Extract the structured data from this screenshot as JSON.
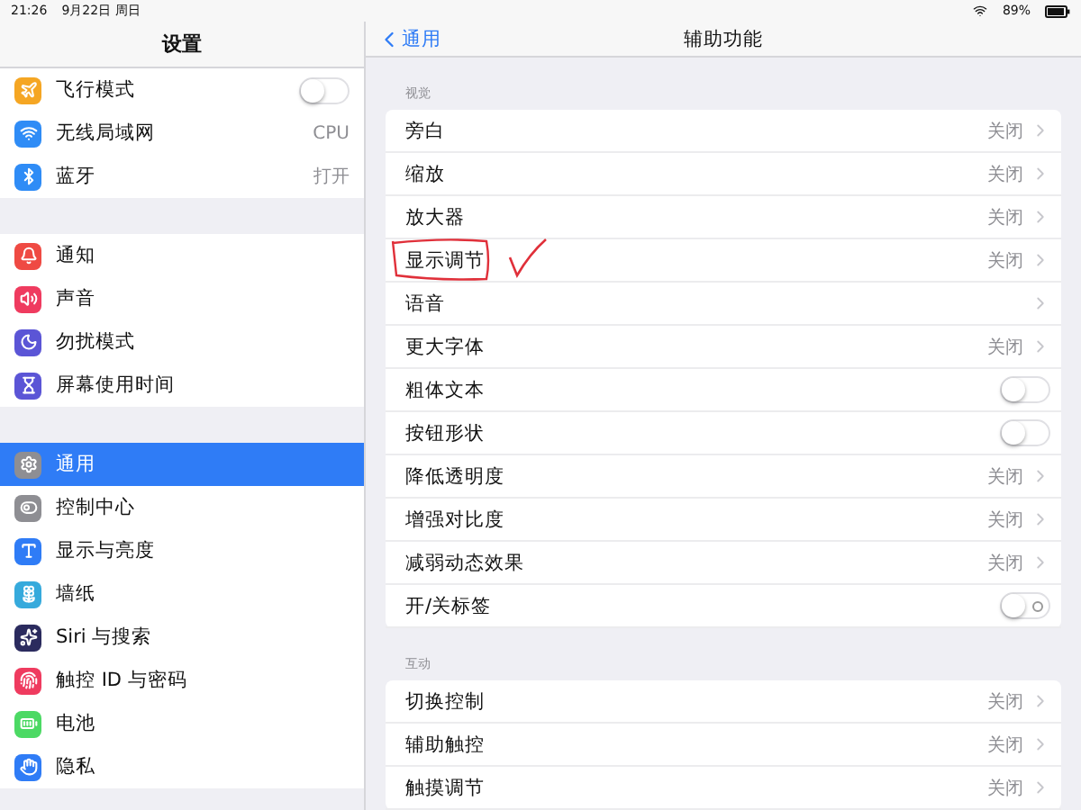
{
  "status_bar": {
    "time": "21:26",
    "date": "9月22日 周日",
    "battery": "89%"
  },
  "sidebar": {
    "title": "设置",
    "groups": [
      [
        {
          "label": "飞行模式",
          "color": "#f5a623",
          "kind": "toggle",
          "on": false
        },
        {
          "label": "无线局域网",
          "color": "#2f8cf6",
          "kind": "value",
          "value": "CPU"
        },
        {
          "label": "蓝牙",
          "color": "#2f8cf6",
          "kind": "value",
          "value": "打开"
        }
      ],
      [
        {
          "label": "通知",
          "color": "#ef4a43",
          "kind": "link"
        },
        {
          "label": "声音",
          "color": "#ef3b5f",
          "kind": "link"
        },
        {
          "label": "勿扰模式",
          "color": "#5b55d6",
          "kind": "link"
        },
        {
          "label": "屏幕使用时间",
          "color": "#5b55d6",
          "kind": "link"
        }
      ],
      [
        {
          "label": "通用",
          "color": "#8e8e93",
          "kind": "link",
          "selected": true
        },
        {
          "label": "控制中心",
          "color": "#8e8e93",
          "kind": "link",
          "selected": false
        },
        {
          "label": "显示与亮度",
          "color": "#2f7cf6",
          "kind": "link",
          "selected": false
        },
        {
          "label": "墙纸",
          "color": "#36aadc",
          "kind": "link",
          "selected": false
        },
        {
          "label": "Siri 与搜索",
          "color": "#2b2b5e",
          "kind": "link",
          "selected": false
        },
        {
          "label": "触控 ID 与密码",
          "color": "#ef3b5f",
          "kind": "link",
          "selected": false
        },
        {
          "label": "电池",
          "color": "#4cd964",
          "kind": "link",
          "selected": false
        },
        {
          "label": "隐私",
          "color": "#2f7cf6",
          "kind": "link",
          "selected": false
        }
      ]
    ]
  },
  "detail": {
    "back": "通用",
    "title": "辅助功能",
    "sections": [
      {
        "header": "视觉",
        "rows": [
          {
            "label": "旁白",
            "kind": "value",
            "value": "关闭"
          },
          {
            "label": "缩放",
            "kind": "value",
            "value": "关闭"
          },
          {
            "label": "放大器",
            "kind": "value",
            "value": "关闭"
          },
          {
            "label": "显示调节",
            "kind": "value",
            "value": "关闭",
            "annotated": true
          },
          {
            "label": "语音",
            "kind": "link"
          },
          {
            "label": "更大字体",
            "kind": "value",
            "value": "关闭"
          },
          {
            "label": "粗体文本",
            "kind": "toggle",
            "on": false
          },
          {
            "label": "按钮形状",
            "kind": "toggle",
            "on": false
          },
          {
            "label": "降低透明度",
            "kind": "value",
            "value": "关闭"
          },
          {
            "label": "增强对比度",
            "kind": "value",
            "value": "关闭"
          },
          {
            "label": "减弱动态效果",
            "kind": "value",
            "value": "关闭"
          },
          {
            "label": "开/关标签",
            "kind": "labeled-toggle",
            "on": false
          }
        ]
      },
      {
        "header": "互动",
        "rows": [
          {
            "label": "切换控制",
            "kind": "value",
            "value": "关闭"
          },
          {
            "label": "辅助触控",
            "kind": "value",
            "value": "关闭"
          },
          {
            "label": "触摸调节",
            "kind": "value",
            "value": "关闭"
          }
        ]
      }
    ]
  }
}
